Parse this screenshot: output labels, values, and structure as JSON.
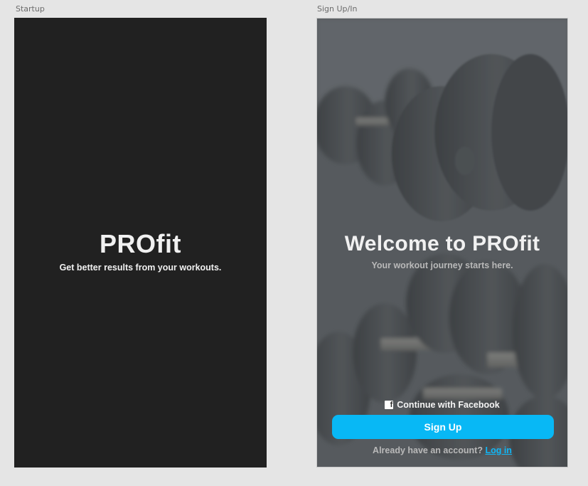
{
  "artboards": {
    "startup_label": "Startup",
    "signup_label": "Sign Up/In"
  },
  "startup": {
    "title": "PROfit",
    "tagline": "Get better results from your workouts."
  },
  "signup": {
    "title": "Welcome to PROfit",
    "subtitle": "Your workout journey starts here.",
    "facebook_icon": "facebook-icon",
    "facebook_label": "Continue with Facebook",
    "signup_label": "Sign Up",
    "login_prompt": "Already have an account?",
    "login_link": "Log in"
  },
  "colors": {
    "canvas": "#e5e5e5",
    "startup_bg": "#212121",
    "accent": "#08b8f5",
    "link": "#0fb7f7"
  }
}
